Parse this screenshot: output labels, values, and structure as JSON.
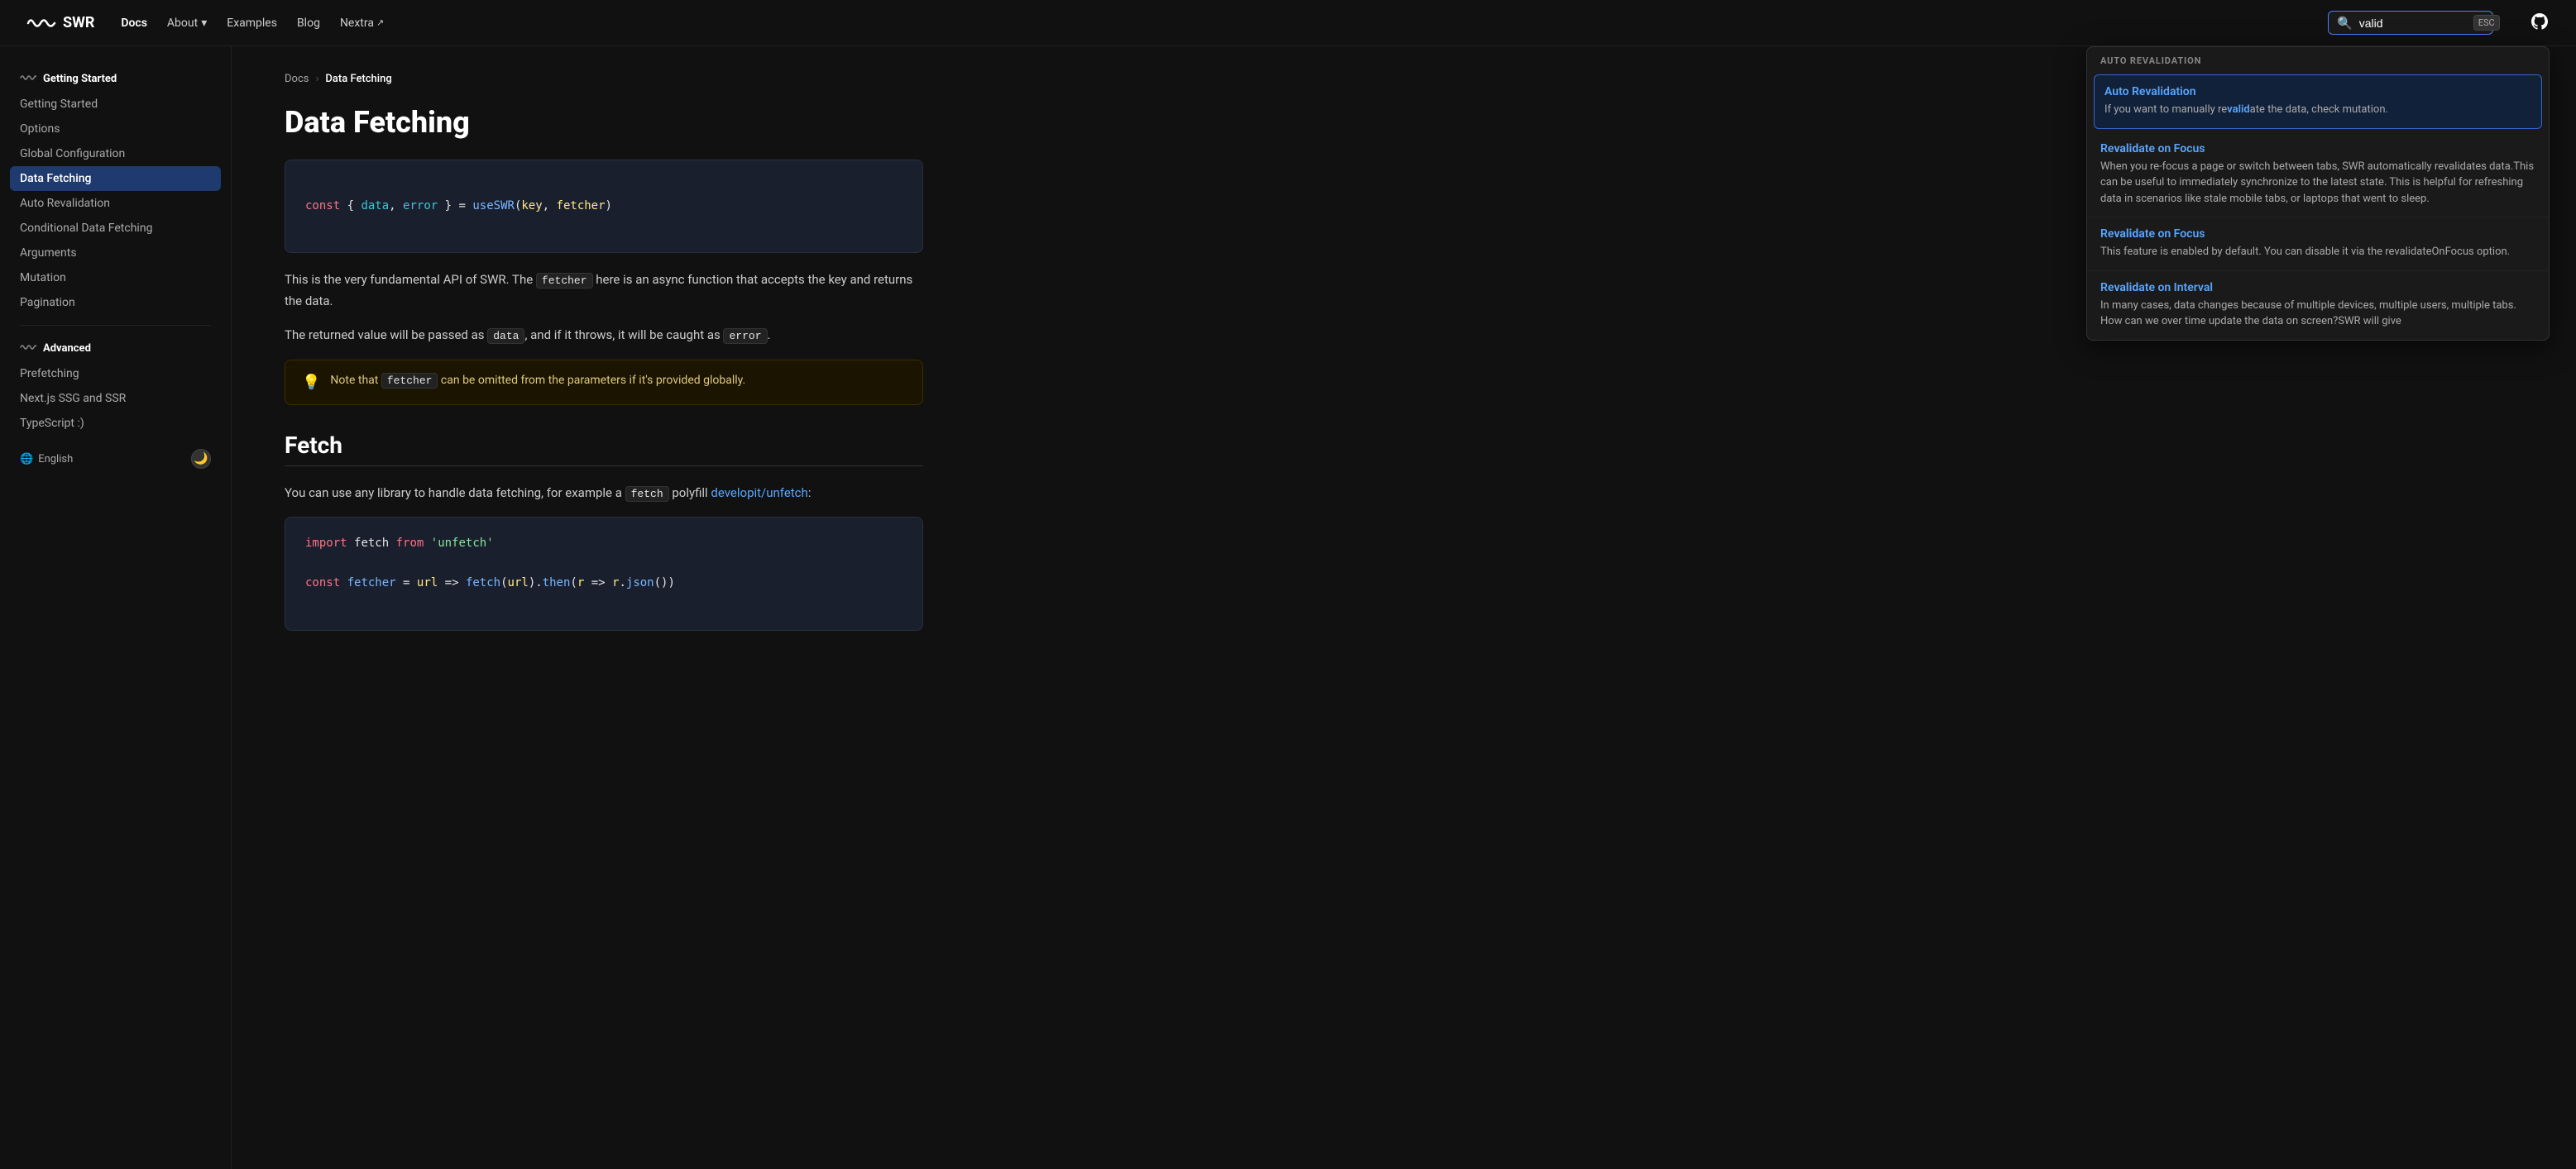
{
  "nav": {
    "logo_text": "SWR",
    "links": [
      {
        "label": "Docs",
        "active": true,
        "has_arrow": false,
        "external": false
      },
      {
        "label": "About",
        "active": false,
        "has_arrow": true,
        "external": false
      },
      {
        "label": "Examples",
        "active": false,
        "has_arrow": false,
        "external": false
      },
      {
        "label": "Blog",
        "active": false,
        "has_arrow": false,
        "external": false
      },
      {
        "label": "Nextra",
        "active": false,
        "has_arrow": false,
        "external": true
      }
    ],
    "search_placeholder": "valid",
    "esc_label": "ESC"
  },
  "sidebar": {
    "sections": [
      {
        "title": "Getting Started",
        "items": [
          {
            "label": "Getting Started",
            "active": false
          },
          {
            "label": "Options",
            "active": false
          },
          {
            "label": "Global Configuration",
            "active": false
          },
          {
            "label": "Data Fetching",
            "active": true
          },
          {
            "label": "Auto Revalidation",
            "active": false
          },
          {
            "label": "Conditional Data Fetching",
            "active": false
          },
          {
            "label": "Arguments",
            "active": false
          },
          {
            "label": "Mutation",
            "active": false
          },
          {
            "label": "Pagination",
            "active": false
          }
        ]
      },
      {
        "title": "Advanced",
        "items": [
          {
            "label": "Prefetching",
            "active": false
          },
          {
            "label": "Next.js SSG and SSR",
            "active": false
          },
          {
            "label": "TypeScript :)",
            "active": false
          }
        ]
      }
    ],
    "footer": {
      "language": "English",
      "dark_mode_icon": "🌙"
    }
  },
  "breadcrumb": {
    "parent": "Docs",
    "current": "Data Fetching"
  },
  "page": {
    "title": "Data Fetching",
    "code_block_1": "const { data, error } = useSWR(key, fetcher)",
    "intro_text_1": "This is the very fundamental API of SWR. The ",
    "fetcher_inline": "fetcher",
    "intro_text_2": " here is an async function that accepts the ",
    "intro_text_3": "and returns the data.",
    "intro_text_returned": "The returned value will be passed as ",
    "data_inline": "data",
    "intro_text_4": ", and if it throws, it will be...",
    "note_text": "Note that ",
    "fetcher_note": "fetcher",
    "note_text_2": " can be omitted from the parameters if it's...",
    "section_fetch": "Fetch",
    "fetch_prose_1": "You can use any library to handle data fetching, for example a ",
    "fetch_inline": "fetch",
    "fetch_prose_2": " polyfill ",
    "fetch_link": "developit/unfetch",
    "fetch_prose_3": ":",
    "code_block_2_line1": "import fetch from 'unfetch'",
    "code_block_2_line2": "const fetcher = url => fetch(url).then(r => r.json())"
  },
  "search_dropdown": {
    "section_label": "AUTO REVALIDATION",
    "results": [
      {
        "title": "Auto Revalidation",
        "desc_before": "If you want to manually re",
        "highlight": "valid",
        "desc_after": "ate the data, check mutation.",
        "highlighted": true
      },
      {
        "title_prefix": "Re",
        "title_highlight": "valid",
        "title_suffix": "ate on Focus",
        "desc": "When you re-focus a page or switch between tabs, SWR automatically revalidates data.This can be useful to immediately synchronize to the latest state. This is helpful for refreshing data in scenarios like stale mobile tabs, or laptops that went to sleep.",
        "highlighted": false
      },
      {
        "title_prefix": "Re",
        "title_highlight": "valid",
        "title_suffix": "ate on Focus",
        "desc": "This feature is enabled by default. You can disable it via the revalidateOnFocus option.",
        "highlighted": false
      },
      {
        "title_prefix": "Re",
        "title_highlight": "valid",
        "title_suffix": "ate on Interval",
        "desc": "In many cases, data changes because of multiple devices, multiple users, multiple tabs. How can we over time update the data on screen?SWR will give",
        "highlighted": false
      }
    ]
  }
}
